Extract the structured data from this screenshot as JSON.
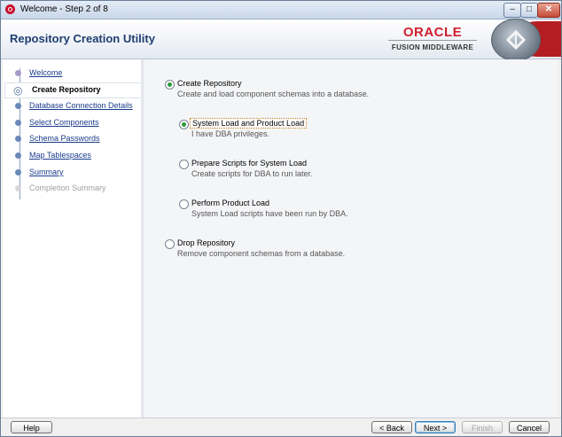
{
  "window": {
    "title": "Welcome - Step 2 of 8",
    "controls": [
      "minimize-icon",
      "maximize-icon",
      "close-icon"
    ]
  },
  "header": {
    "title": "Repository Creation Utility",
    "brand": "ORACLE",
    "brand_sub": "FUSION MIDDLEWARE"
  },
  "nav": {
    "items": [
      {
        "label": "Welcome",
        "state": "done"
      },
      {
        "label": "Create Repository",
        "state": "current"
      },
      {
        "label": "Database Connection Details",
        "state": "link"
      },
      {
        "label": "Select Components",
        "state": "link"
      },
      {
        "label": "Schema Passwords",
        "state": "link"
      },
      {
        "label": "Map Tablespaces",
        "state": "link"
      },
      {
        "label": "Summary",
        "state": "link"
      },
      {
        "label": "Completion Summary",
        "state": "disabled"
      }
    ]
  },
  "options": {
    "create": {
      "label": "Create Repository",
      "desc": "Create and load component schemas into a database.",
      "selected": true
    },
    "system_product": {
      "label": "System Load and Product Load",
      "desc": "I have DBA privileges.",
      "selected": true
    },
    "prepare_scripts": {
      "label": "Prepare Scripts for System Load",
      "desc": "Create scripts for DBA to run later.",
      "selected": false
    },
    "product_load": {
      "label": "Perform Product Load",
      "desc": "System Load scripts have been run by DBA.",
      "selected": false
    },
    "drop": {
      "label": "Drop Repository",
      "desc": "Remove component schemas from a database.",
      "selected": false
    }
  },
  "buttons": {
    "help": "Help",
    "back": "< Back",
    "next": "Next >",
    "finish": "Finish",
    "cancel": "Cancel"
  },
  "colors": {
    "title_blue": "#1f3e70",
    "oracle_red": "#d01f2d",
    "link_blue": "#1a3c8c",
    "radio_green": "#2c9a3a"
  }
}
